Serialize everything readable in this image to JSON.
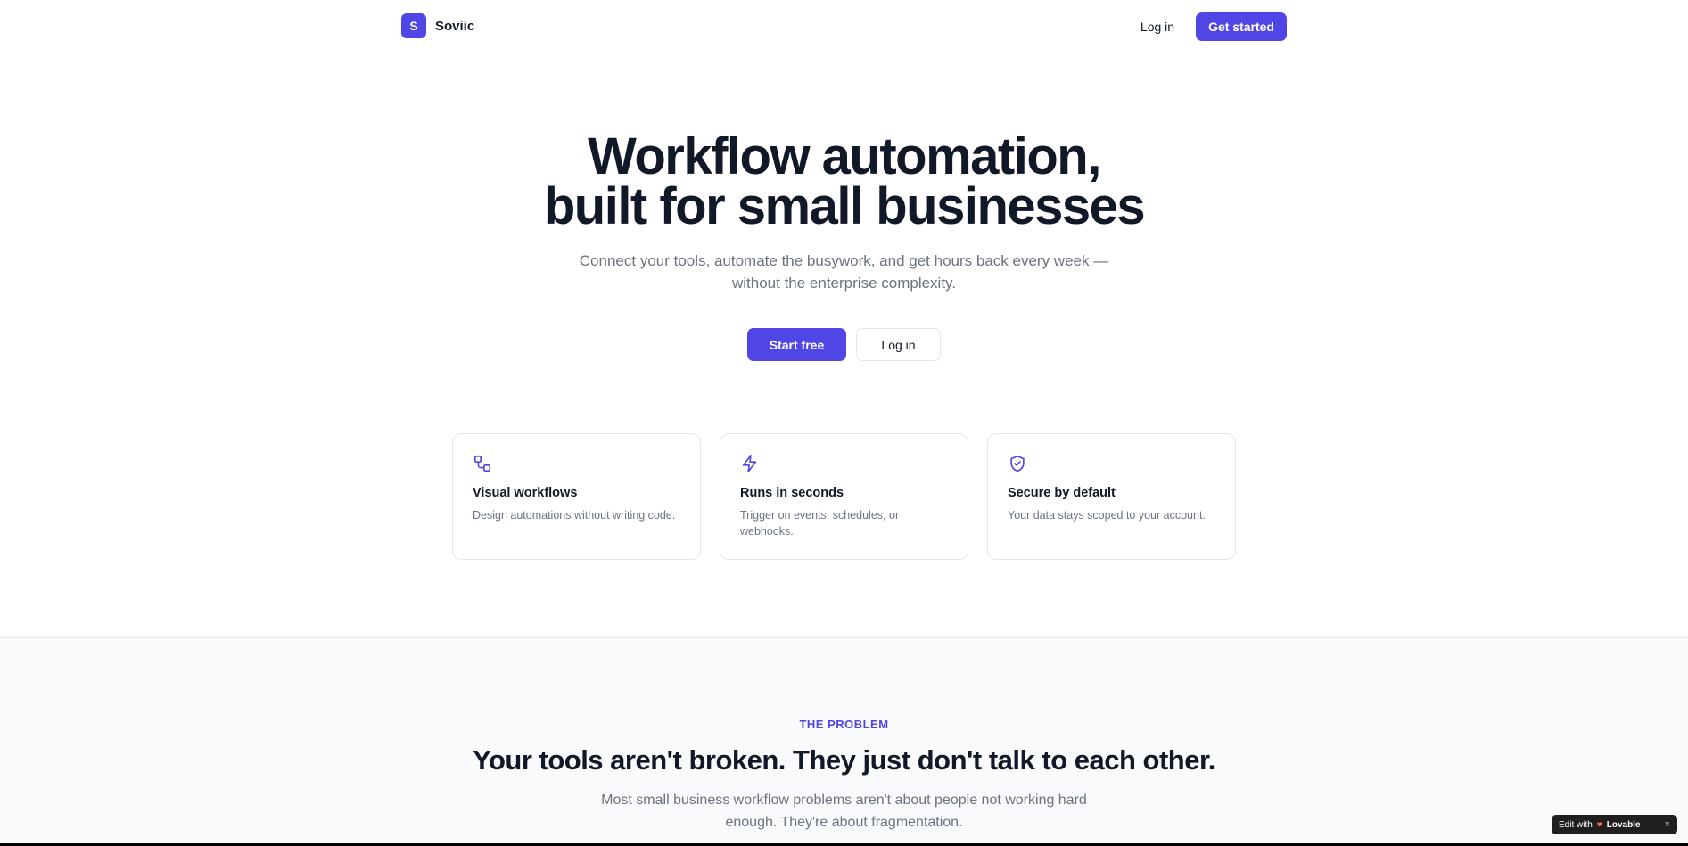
{
  "nav": {
    "logo_letter": "S",
    "brand": "Soviic",
    "login": "Log in",
    "cta": "Get started"
  },
  "hero": {
    "title_line1": "Workflow automation,",
    "title_line2": "built for small businesses",
    "subtitle": "Connect your tools, automate the busywork, and get hours back every week — without the enterprise complexity.",
    "primary_button": "Start free",
    "secondary_button": "Log in"
  },
  "features": [
    {
      "icon": "workflow-icon",
      "title": "Visual workflows",
      "desc": "Design automations without writing code."
    },
    {
      "icon": "lightning-icon",
      "title": "Runs in seconds",
      "desc": "Trigger on events, schedules, or webhooks."
    },
    {
      "icon": "shield-check-icon",
      "title": "Secure by default",
      "desc": "Your data stays scoped to your account."
    }
  ],
  "problem": {
    "eyebrow": "THE PROBLEM",
    "title": "Your tools aren't broken. They just don't talk to each other.",
    "subtitle": "Most small business workflow problems aren't about people not working hard enough. They're about fragmentation."
  },
  "badge": {
    "prefix": "Edit with",
    "brand": "Lovable",
    "close": "×"
  },
  "colors": {
    "accent": "#4f46e5",
    "text": "#111827",
    "muted": "#6b7280",
    "border": "#e5e7eb",
    "section_bg": "#f9fafb"
  }
}
